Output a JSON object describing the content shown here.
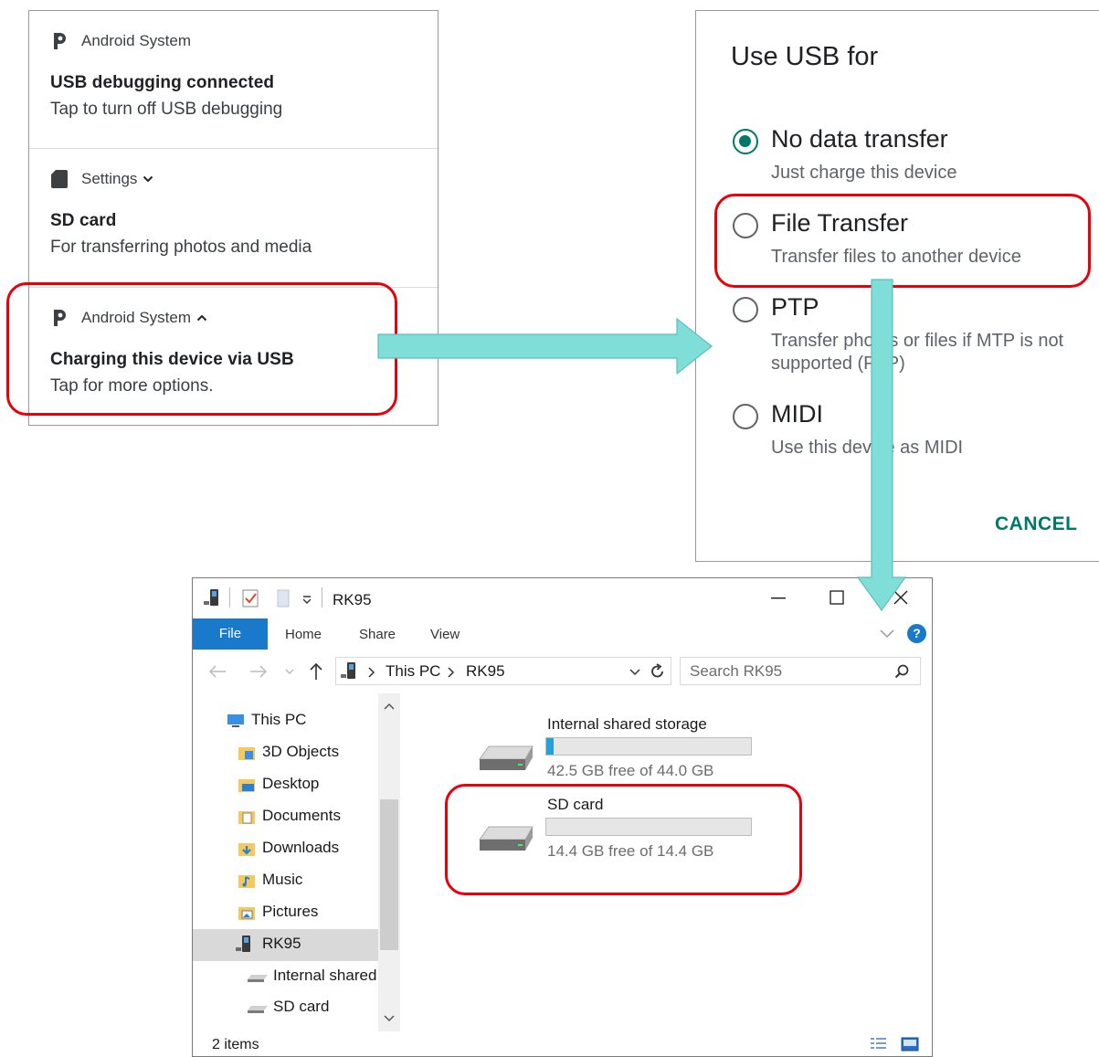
{
  "notifications": [
    {
      "app": "Android System",
      "icon": "android-system-icon",
      "title": "USB debugging connected",
      "subtitle": "Tap to turn off USB debugging",
      "chevron": ""
    },
    {
      "app": "Settings",
      "icon": "sd-card-icon",
      "title": "SD card",
      "subtitle": "For transferring photos and media",
      "chevron": "down"
    },
    {
      "app": "Android System",
      "icon": "android-system-icon",
      "title": "Charging this device via USB",
      "subtitle": "Tap for more options.",
      "chevron": "up"
    }
  ],
  "usb_dialog": {
    "title": "Use USB for",
    "options": [
      {
        "label": "No data transfer",
        "desc": "Just charge this device",
        "selected": true
      },
      {
        "label": "File Transfer",
        "desc": "Transfer files to another device",
        "selected": false
      },
      {
        "label": "PTP",
        "desc": "Transfer photos or files if MTP is not supported (PTP)",
        "selected": false
      },
      {
        "label": "MIDI",
        "desc": "Use this device as MIDI",
        "selected": false
      }
    ],
    "cancel": "CANCEL",
    "accent": "#00796b"
  },
  "explorer": {
    "window_title": "RK95",
    "ribbon": {
      "file": "File",
      "home": "Home",
      "share": "Share",
      "view": "View",
      "help": "?"
    },
    "address": {
      "crumb1": "This PC",
      "crumb2": "RK95"
    },
    "search_placeholder": "Search RK95",
    "nav_items": [
      {
        "label": "This PC",
        "icon": "this-pc-icon"
      },
      {
        "label": "3D Objects",
        "icon": "3d-objects-folder-icon"
      },
      {
        "label": "Desktop",
        "icon": "desktop-folder-icon"
      },
      {
        "label": "Documents",
        "icon": "documents-folder-icon"
      },
      {
        "label": "Downloads",
        "icon": "downloads-folder-icon"
      },
      {
        "label": "Music",
        "icon": "music-folder-icon"
      },
      {
        "label": "Pictures",
        "icon": "pictures-folder-icon"
      },
      {
        "label": "RK95",
        "icon": "device-icon"
      },
      {
        "label": "Internal shared",
        "icon": "drive-icon"
      },
      {
        "label": "SD card",
        "icon": "drive-icon"
      }
    ],
    "drives": [
      {
        "name": "Internal shared storage",
        "free": "42.5 GB free of 44.0 GB",
        "used_fraction": 0.034
      },
      {
        "name": "SD card",
        "free": "14.4 GB free of 14.4 GB",
        "used_fraction": 0.0
      }
    ],
    "status": "2 items",
    "accent": "#1979ca"
  },
  "colors": {
    "highlight": "#e8000b",
    "arrow": "#7fded8"
  }
}
